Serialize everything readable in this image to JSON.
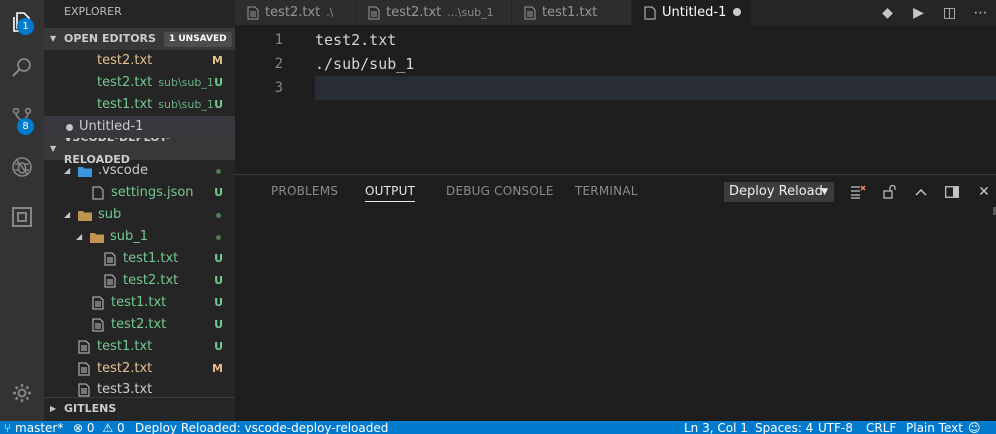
{
  "activity": {
    "explorer_badge": "1",
    "scm_badge": "8"
  },
  "sidebar": {
    "title": "EXPLORER",
    "open_editors": {
      "label": "OPEN EDITORS",
      "unsaved_badge": "1 UNSAVED",
      "items": [
        {
          "name": "test2.txt",
          "desc": "",
          "deco": "M"
        },
        {
          "name": "test2.txt",
          "desc": "sub\\sub_1",
          "deco": "U"
        },
        {
          "name": "test1.txt",
          "desc": "sub\\sub_1",
          "deco": "U"
        },
        {
          "name": "Untitled-1",
          "desc": "",
          "deco": ""
        }
      ]
    },
    "project": {
      "label": "VSCODE-DEPLOY-RELOADED",
      "items": [
        {
          "name": ".vscode",
          "deco": ""
        },
        {
          "name": "settings.json",
          "deco": "U"
        },
        {
          "name": "sub",
          "deco": ""
        },
        {
          "name": "sub_1",
          "deco": ""
        },
        {
          "name": "test1.txt",
          "deco": "U"
        },
        {
          "name": "test2.txt",
          "deco": "U"
        },
        {
          "name": "test1.txt",
          "deco": "U"
        },
        {
          "name": "test2.txt",
          "deco": "U"
        },
        {
          "name": "test1.txt",
          "deco": "U"
        },
        {
          "name": "test2.txt",
          "deco": "M"
        },
        {
          "name": "test3.txt",
          "deco": ""
        }
      ]
    },
    "gitlens": {
      "label": "GITLENS"
    }
  },
  "tabs": [
    {
      "name": "test2.txt",
      "desc": ".\\"
    },
    {
      "name": "test2.txt",
      "desc": "...\\sub_1"
    },
    {
      "name": "test1.txt",
      "desc": ""
    },
    {
      "name": "Untitled-1",
      "desc": ""
    }
  ],
  "editor": {
    "line_numbers": [
      "1",
      "2",
      "3"
    ],
    "lines": [
      "test2.txt",
      "./sub/sub_1",
      ""
    ]
  },
  "panel": {
    "tabs": [
      "PROBLEMS",
      "OUTPUT",
      "DEBUG CONSOLE",
      "TERMINAL"
    ],
    "output_channel": "Deploy Reload"
  },
  "status": {
    "branch": "master*",
    "errors": "0",
    "warnings": "0",
    "message": "Deploy Reloaded: vscode-deploy-reloaded",
    "position": "Ln 3, Col 1",
    "spaces": "Spaces: 4",
    "encoding": "UTF-8",
    "eol": "CRLF",
    "language": "Plain Text"
  },
  "colors": {
    "accent": "#007acc",
    "modified": "#e2c08d",
    "untracked": "#73c991",
    "folder_dot": "#527a55"
  }
}
